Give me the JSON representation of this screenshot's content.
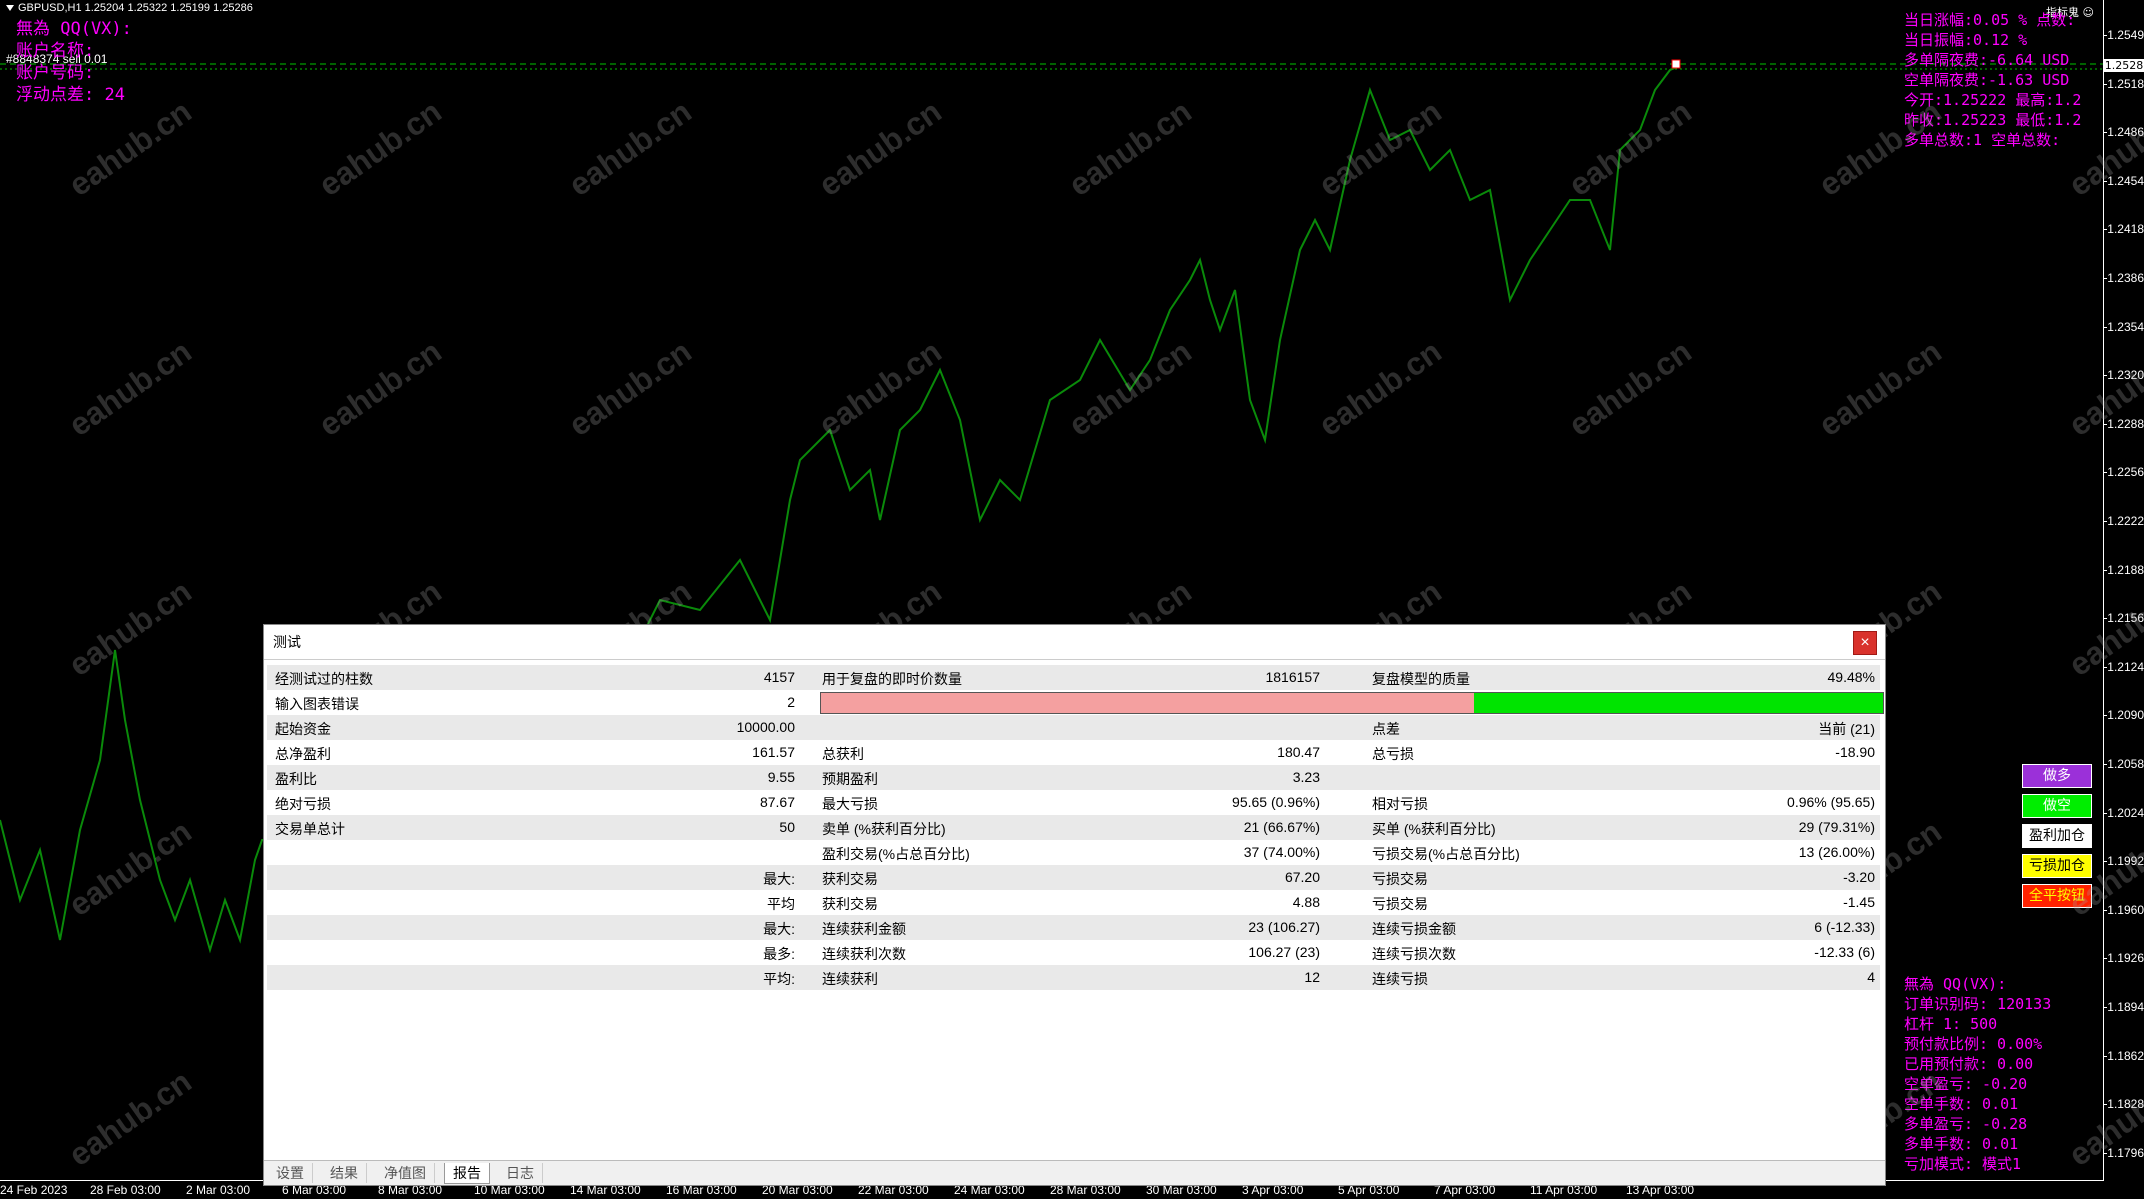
{
  "chart": {
    "symbol_line": "GBPUSD,H1  1.25204 1.25322 1.25199 1.25286",
    "order_label": "#8848374 sell 0.01",
    "indicator_label": "指标鬼",
    "current_price": "1.2528",
    "price_ticks": [
      "1.2549",
      "1.2518",
      "1.2486",
      "1.2454",
      "1.2418",
      "1.2386",
      "1.2354",
      "1.2320",
      "1.2288",
      "1.2256",
      "1.2222",
      "1.2188",
      "1.2156",
      "1.2124",
      "1.2090",
      "1.2058",
      "1.2024",
      "1.1992",
      "1.1960",
      "1.1926",
      "1.1894",
      "1.1862",
      "1.1828",
      "1.1796"
    ],
    "time_ticks": [
      "24 Feb 2023",
      "28 Feb 03:00",
      "2 Mar 03:00",
      "6 Mar 03:00",
      "8 Mar 03:00",
      "10 Mar 03:00",
      "14 Mar 03:00",
      "16 Mar 03:00",
      "20 Mar 03:00",
      "22 Mar 03:00",
      "24 Mar 03:00",
      "28 Mar 03:00",
      "30 Mar 03:00",
      "3 Apr 03:00",
      "5 Apr 03:00",
      "7 Apr 03:00",
      "11 Apr 03:00",
      "13 Apr 03:00"
    ],
    "watermark": "eahub.cn"
  },
  "top_left_info": [
    "無為 QQ(VX):",
    "账户名称:",
    "账户号码:",
    "浮动点差: 24"
  ],
  "top_right_info": [
    "当日涨幅:0.05 % 点数:",
    "当日振幅:0.12 %",
    "多单隔夜费:-6.64 USD",
    "空单隔夜费:-1.63 USD",
    "今开:1.25222  最高:1.2",
    "昨收:1.25223  最低:1.2",
    "多单总数:1  空单总数:"
  ],
  "bottom_right_info": [
    "無為 QQ(VX):",
    "订单识别码: 120133",
    "杠杆 1: 500",
    "预付款比例: 0.00%",
    "已用预付款: 0.00",
    "空单盈亏: -0.20",
    "空单手数: 0.01",
    "多单盈亏: -0.28",
    "多单手数: 0.01",
    "亏加模式: 模式1"
  ],
  "side_buttons": [
    {
      "label": "做多",
      "bg": "#9b30d9",
      "fg": "#ffffff"
    },
    {
      "label": "做空",
      "bg": "#00ee00",
      "fg": "#ffffff"
    },
    {
      "label": "盈利加仓",
      "bg": "#ffffff",
      "fg": "#000000"
    },
    {
      "label": "亏损加仓",
      "bg": "#ffff00",
      "fg": "#000000"
    },
    {
      "label": "全平按钮",
      "bg": "#ff2200",
      "fg": "#ffff00"
    }
  ],
  "dialog": {
    "title": "测试",
    "close_icon": "×",
    "quality": {
      "error_fraction": 0.385,
      "label_left": "输入图表错误",
      "value_left": "2"
    },
    "rows": [
      {
        "c1": "经测试过的柱数",
        "v1": "4157",
        "c2": "用于复盘的即时价数量",
        "v2": "1816157",
        "c3": "复盘模型的质量",
        "v3": "49.48%"
      },
      {
        "c1": "输入图表错误",
        "v1": "2",
        "c2": "",
        "v2": "",
        "c3": "",
        "v3": ""
      },
      {
        "c1": "起始资金",
        "v1": "10000.00",
        "c2": "",
        "v2": "",
        "c3": "点差",
        "v3": "当前 (21)"
      },
      {
        "c1": "总净盈利",
        "v1": "161.57",
        "c2": "总获利",
        "v2": "180.47",
        "c3": "总亏损",
        "v3": "-18.90"
      },
      {
        "c1": "盈利比",
        "v1": "9.55",
        "c2": "预期盈利",
        "v2": "3.23",
        "c3": "",
        "v3": ""
      },
      {
        "c1": "绝对亏损",
        "v1": "87.67",
        "c2": "最大亏损",
        "v2": "95.65 (0.96%)",
        "c3": "相对亏损",
        "v3": "0.96% (95.65)"
      },
      {
        "c1": "交易单总计",
        "v1": "50",
        "c2": "卖单 (%获利百分比)",
        "v2": "21 (66.67%)",
        "c3": "买单 (%获利百分比)",
        "v3": "29 (79.31%)"
      },
      {
        "c1": "",
        "v1": "",
        "c2": "盈利交易(%占总百分比)",
        "v2": "37 (74.00%)",
        "c3": "亏损交易(%占总百分比)",
        "v3": "13 (26.00%)"
      },
      {
        "c1": "",
        "v1": "最大:",
        "c2": "获利交易",
        "v2": "67.20",
        "c3": "亏损交易",
        "v3": "-3.20"
      },
      {
        "c1": "",
        "v1": "平均",
        "c2": "获利交易",
        "v2": "4.88",
        "c3": "亏损交易",
        "v3": "-1.45"
      },
      {
        "c1": "",
        "v1": "最大:",
        "c2": "连续获利金额",
        "v2": "23 (106.27)",
        "c3": "连续亏损金额",
        "v3": "6 (-12.33)"
      },
      {
        "c1": "",
        "v1": "最多:",
        "c2": "连续获利次数",
        "v2": "106.27 (23)",
        "c3": "连续亏损次数",
        "v3": "-12.33 (6)"
      },
      {
        "c1": "",
        "v1": "平均:",
        "c2": "连续获利",
        "v2": "12",
        "c3": "连续亏损",
        "v3": "4"
      }
    ],
    "tabs": [
      "设置",
      "结果",
      "净值图",
      "报告",
      "日志"
    ],
    "active_tab": 3
  }
}
